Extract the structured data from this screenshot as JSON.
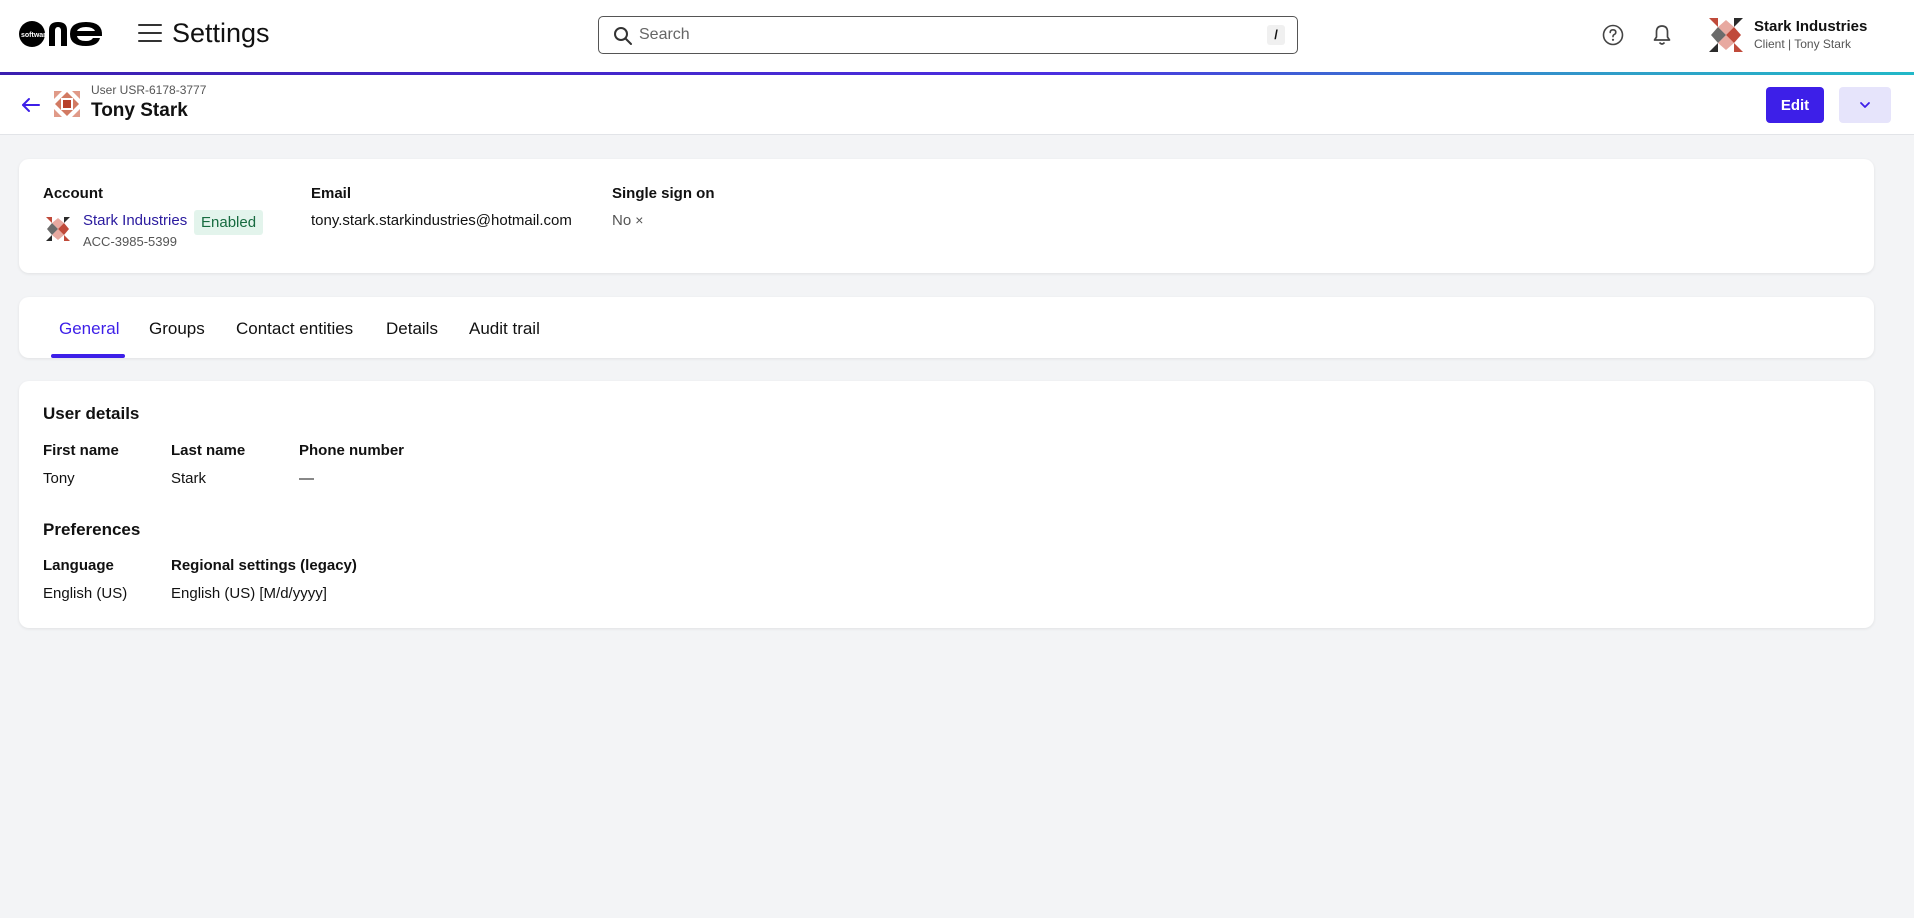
{
  "header": {
    "app_title": "Settings",
    "search_placeholder": "Search",
    "search_shortcut": "/",
    "org_name": "Stark Industries",
    "org_subtitle": "Client | Tony Stark"
  },
  "page": {
    "record_id": "User USR-6178-3777",
    "record_name": "Tony Stark",
    "edit_label": "Edit"
  },
  "summary": {
    "account_label": "Account",
    "account_name": "Stark Industries",
    "account_status": "Enabled",
    "account_id": "ACC-3985-5399",
    "email_label": "Email",
    "email_value": "tony.stark.starkindustries@hotmail.com",
    "sso_label": "Single sign on",
    "sso_value": "No"
  },
  "tabs": [
    {
      "label": "General",
      "active": true
    },
    {
      "label": "Groups"
    },
    {
      "label": "Contact entities"
    },
    {
      "label": "Details"
    },
    {
      "label": "Audit trail"
    }
  ],
  "user_details": {
    "title": "User details",
    "first_name_label": "First name",
    "first_name": "Tony",
    "last_name_label": "Last name",
    "last_name": "Stark",
    "phone_label": "Phone number",
    "phone": "—"
  },
  "preferences": {
    "title": "Preferences",
    "language_label": "Language",
    "language": "English (US)",
    "regional_label": "Regional settings (legacy)",
    "regional": "English (US) [M/d/yyyy]"
  },
  "colors": {
    "accent": "#3d1fe8",
    "status_enabled_bg": "#e3f4ec",
    "status_enabled_text": "#176b40"
  },
  "icons": [
    "logo",
    "hamburger-icon",
    "search-icon",
    "help-icon",
    "bell-icon",
    "org-avatar",
    "back-arrow-icon",
    "user-avatar",
    "chevron-down-icon",
    "account-avatar",
    "close-icon"
  ]
}
